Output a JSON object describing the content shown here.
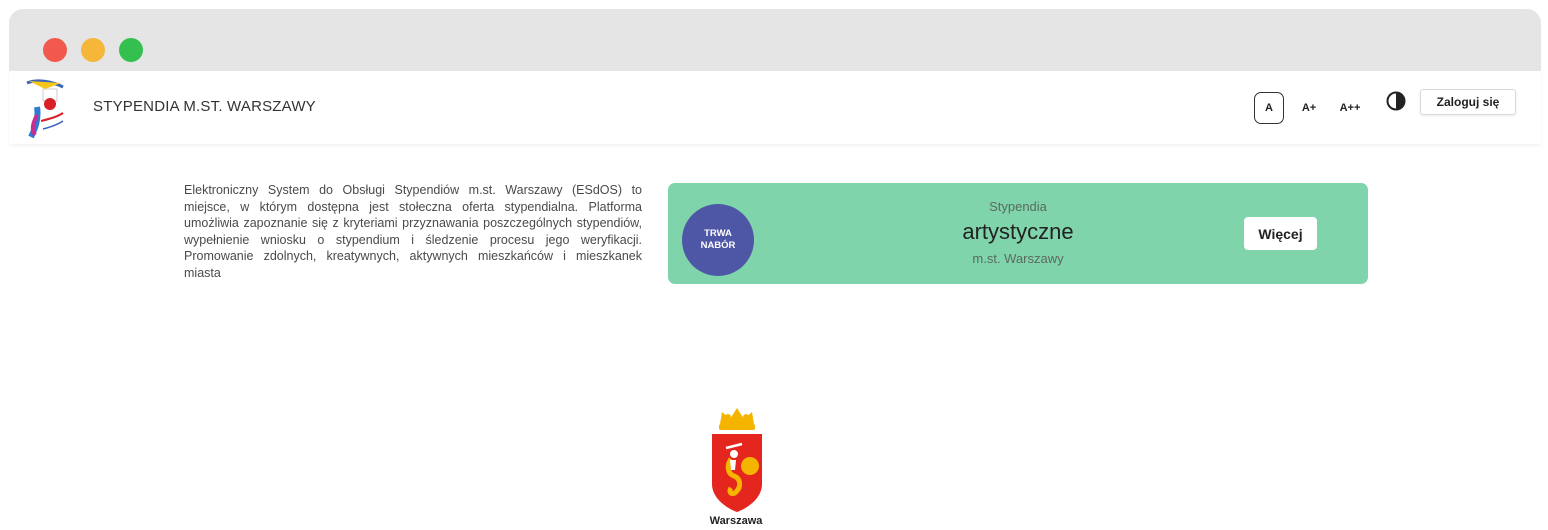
{
  "window": {
    "controls": [
      "close",
      "minimize",
      "maximize"
    ],
    "colors": {
      "close": "#f1594e",
      "minimize": "#f6b63a",
      "maximize": "#34c04f"
    }
  },
  "header": {
    "title": "STYPENDIA M.ST. WARSZAWY",
    "font_size_buttons": [
      "A",
      "A+",
      "A++"
    ],
    "contrast_icon": "contrast-icon",
    "login_label": "Zaloguj się"
  },
  "intro": {
    "text": "Elektroniczny System do Obsługi Stypendiów m.st. Warszawy (ESdOS) to miejsce, w którym dostępna jest stołeczna oferta stypendialna. Platforma umożliwia zapoznanie się z kryteriami przyznawania poszczególnych stypendiów, wypełnienie wniosku o stypendium i śledzenie procesu jego weryfikacji. Promowanie zdolnych, kreatywnych, aktywnych mieszkańców i mieszkanek miasta"
  },
  "card": {
    "badge_line1": "TRWA",
    "badge_line2": "NABÓR",
    "label_top": "Stypendia",
    "label_main": "artystyczne",
    "label_sub": "m.st. Warszawy",
    "more_label": "Więcej",
    "colors": {
      "background": "#7fd4ab",
      "badge": "#4e56a6"
    }
  },
  "footer": {
    "caption": "Warszawa",
    "crest_icon": "warsaw-crest-icon"
  }
}
